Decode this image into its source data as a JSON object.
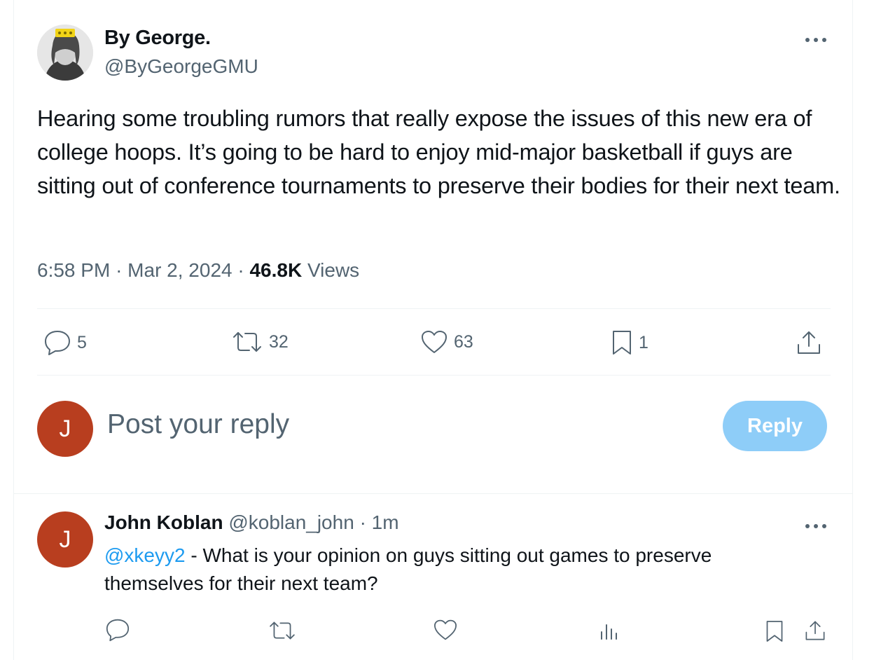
{
  "tweet": {
    "author_name": "By George.",
    "author_handle": "@ByGeorgeGMU",
    "text": "Hearing some troubling rumors that really expose the issues of this new era of college hoops. It’s going to be hard to enjoy mid-major basketball if guys are sitting out of conference tournaments to preserve their bodies for their next team.",
    "time": "6:58 PM",
    "date": "Mar 2, 2024",
    "separator": "·",
    "views_count": "46.8K",
    "views_label": "Views",
    "actions": {
      "replies": "5",
      "reposts": "32",
      "likes": "63",
      "bookmarks": "1"
    }
  },
  "composer": {
    "avatar_initial": "J",
    "placeholder": "Post your reply",
    "reply_button": "Reply"
  },
  "reply": {
    "avatar_initial": "J",
    "author_name": "John Koblan",
    "author_handle": "@koblan_john",
    "separator": "·",
    "time": "1m",
    "mention": "@xkeyy2",
    "text": " - What is your opinion on guys sitting out games to preserve themselves for their next team?"
  },
  "colors": {
    "accent": "#1d9bf0",
    "reply_button_disabled": "#8ecdf8",
    "avatar_bg": "#b83e1f",
    "secondary_text": "#536471"
  }
}
